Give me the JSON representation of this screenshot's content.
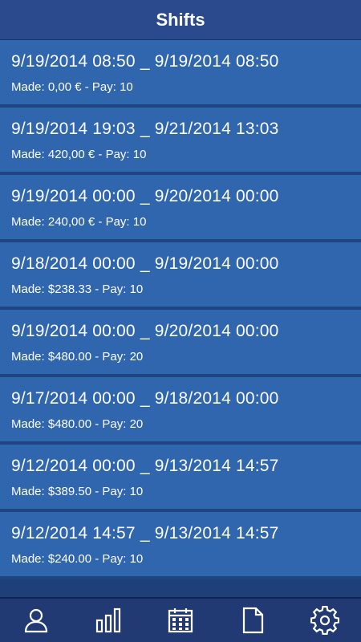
{
  "header": {
    "title": "Shifts"
  },
  "shifts": [
    {
      "range": "9/19/2014 08:50 _ 9/19/2014 08:50",
      "meta": "Made: 0,00 € - Pay: 10"
    },
    {
      "range": "9/19/2014 19:03 _ 9/21/2014 13:03",
      "meta": "Made: 420,00 € - Pay: 10"
    },
    {
      "range": "9/19/2014 00:00 _ 9/20/2014 00:00",
      "meta": "Made: 240,00 € - Pay: 10"
    },
    {
      "range": "9/18/2014 00:00 _ 9/19/2014 00:00",
      "meta": "Made: $238.33 - Pay: 10"
    },
    {
      "range": "9/19/2014 00:00 _ 9/20/2014 00:00",
      "meta": "Made: $480.00 - Pay: 20"
    },
    {
      "range": "9/17/2014 00:00 _ 9/18/2014 00:00",
      "meta": "Made: $480.00 - Pay: 20"
    },
    {
      "range": "9/12/2014 00:00 _ 9/13/2014 14:57",
      "meta": "Made: $389.50 - Pay: 10"
    },
    {
      "range": "9/12/2014 14:57 _ 9/13/2014 14:57",
      "meta": "Made: $240.00 - Pay: 10"
    }
  ],
  "tabbar": {
    "items": [
      {
        "icon": "user-icon"
      },
      {
        "icon": "bar-chart-icon"
      },
      {
        "icon": "calendar-icon"
      },
      {
        "icon": "document-icon"
      },
      {
        "icon": "gear-icon"
      }
    ]
  },
  "colors": {
    "header_bg": "#2a4a8d",
    "row_bg": "#2f66ad",
    "row_divider": "#1e4482",
    "tabbar_bg": "#213a73"
  }
}
